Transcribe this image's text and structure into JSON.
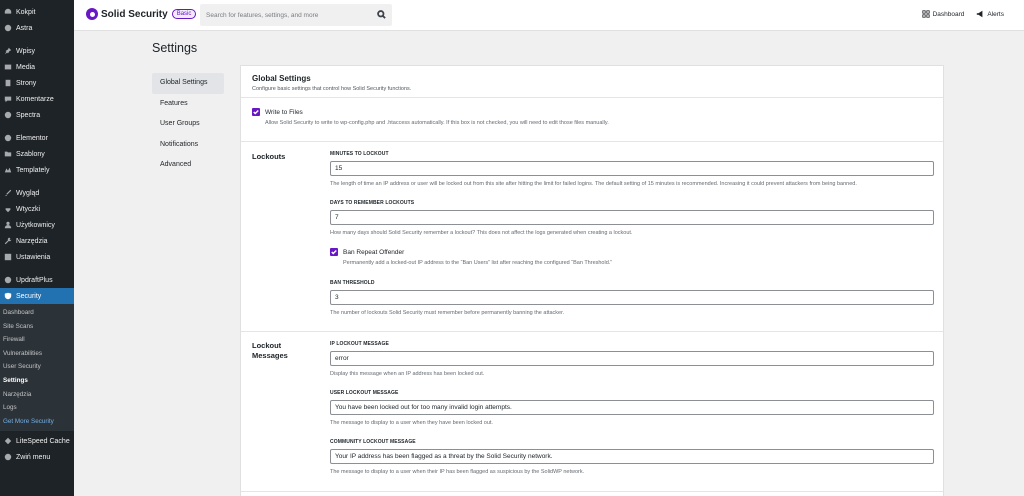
{
  "sidebar": {
    "top_items": [
      {
        "label": "Kokpit",
        "icon": "dashboard-icon"
      },
      {
        "label": "Astra",
        "icon": "astra-icon"
      }
    ],
    "content_items": [
      {
        "label": "Wpisy",
        "icon": "pin-icon"
      },
      {
        "label": "Media",
        "icon": "media-icon"
      },
      {
        "label": "Strony",
        "icon": "page-icon"
      },
      {
        "label": "Komentarze",
        "icon": "comment-icon"
      },
      {
        "label": "Spectra",
        "icon": "spectra-icon"
      }
    ],
    "builder_items": [
      {
        "label": "Elementor",
        "icon": "elementor-icon"
      },
      {
        "label": "Szablony",
        "icon": "folder-icon"
      },
      {
        "label": "Templately",
        "icon": "templately-icon"
      }
    ],
    "admin_items": [
      {
        "label": "Wygląd",
        "icon": "brush-icon"
      },
      {
        "label": "Wtyczki",
        "icon": "plugin-icon"
      },
      {
        "label": "Użytkownicy",
        "icon": "users-icon"
      },
      {
        "label": "Narzędzia",
        "icon": "wrench-icon"
      },
      {
        "label": "Ustawienia",
        "icon": "settings-icon"
      }
    ],
    "updraft": {
      "label": "UpdraftPlus",
      "icon": "updraft-icon"
    },
    "security": {
      "label": "Security",
      "icon": "shield-icon"
    },
    "security_sub": [
      "Dashboard",
      "Site Scans",
      "Firewall",
      "Vulnerabilities",
      "User Security",
      "Settings",
      "Narzędzia",
      "Logs",
      "Get More Security"
    ],
    "litespeed": {
      "label": "LiteSpeed Cache",
      "icon": "litespeed-icon"
    },
    "collapse": {
      "label": "Zwiń menu",
      "icon": "collapse-icon"
    }
  },
  "topbar": {
    "brand": "Solid Security",
    "badge": "Basic",
    "search_placeholder": "Search for features, settings, and more",
    "dashboard_label": "Dashboard",
    "alerts_label": "Alerts"
  },
  "page": {
    "title": "Settings"
  },
  "settings_nav": [
    "Global Settings",
    "Features",
    "User Groups",
    "Notifications",
    "Advanced"
  ],
  "global": {
    "title": "Global Settings",
    "description": "Configure basic settings that control how Solid Security functions.",
    "write_files_label": "Write to Files",
    "write_files_help": "Allow Solid Security to write to wp-config.php and .htaccess automatically. If this box is not checked, you will need to edit those files manually."
  },
  "lockouts": {
    "section_label": "Lockouts",
    "minutes_label": "Minutes to Lockout",
    "minutes_value": "15",
    "minutes_help": "The length of time an IP address or user will be locked out from this site after hitting the limit for failed logins. The default setting of 15 minutes is recommended. Increasing it could prevent attackers from being banned.",
    "days_label": "Days to Remember Lockouts",
    "days_value": "7",
    "days_help": "How many days should Solid Security remember a lockout? This does not affect the logs generated when creating a lockout.",
    "ban_repeat_label": "Ban Repeat Offender",
    "ban_repeat_help": "Permanently add a locked-out IP address to the “Ban Users” list after reaching the configured “Ban Threshold.”",
    "threshold_label": "Ban Threshold",
    "threshold_value": "3",
    "threshold_help": "The number of lockouts Solid Security must remember before permanently banning the attacker."
  },
  "messages": {
    "section_label_1": "Lockout",
    "section_label_2": "Messages",
    "ip_label": "IP Lockout Message",
    "ip_value": "error",
    "ip_help": "Display this message when an IP address has been locked out.",
    "user_label": "User Lockout Message",
    "user_value": "You have been locked out for too many invalid login attempts.",
    "user_help": "The message to display to a user when they have been locked out.",
    "community_label": "Community Lockout Message",
    "community_value": "Your IP address has been flagged as a threat by the Solid Security network.",
    "community_help": "The message to display to a user when their IP has been flagged as suspicious by the SolidWP network."
  },
  "colors": {
    "accent": "#6817c5",
    "wp_blue": "#2271b1",
    "sidebar_bg": "#1d2327"
  }
}
